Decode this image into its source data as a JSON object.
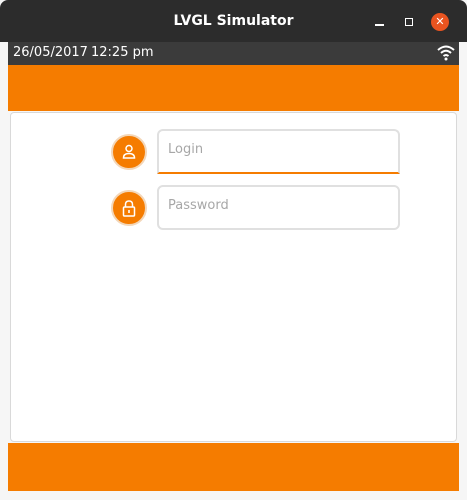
{
  "window": {
    "title": "LVGL Simulator",
    "controls": {
      "minimize": "minimize",
      "maximize": "maximize",
      "close": "close"
    }
  },
  "statusbar": {
    "date": "26/05/2017",
    "time": "12:25 pm",
    "wifi_icon": "wifi-icon"
  },
  "form": {
    "login": {
      "icon": "user-icon",
      "placeholder": "Login",
      "value": ""
    },
    "password": {
      "icon": "lock-icon",
      "placeholder": "Password",
      "value": ""
    }
  },
  "colors": {
    "accent": "#f57c00",
    "titlebar": "#2c2c2c",
    "statusbar": "#3b3b3b",
    "close_button": "#e95420"
  }
}
